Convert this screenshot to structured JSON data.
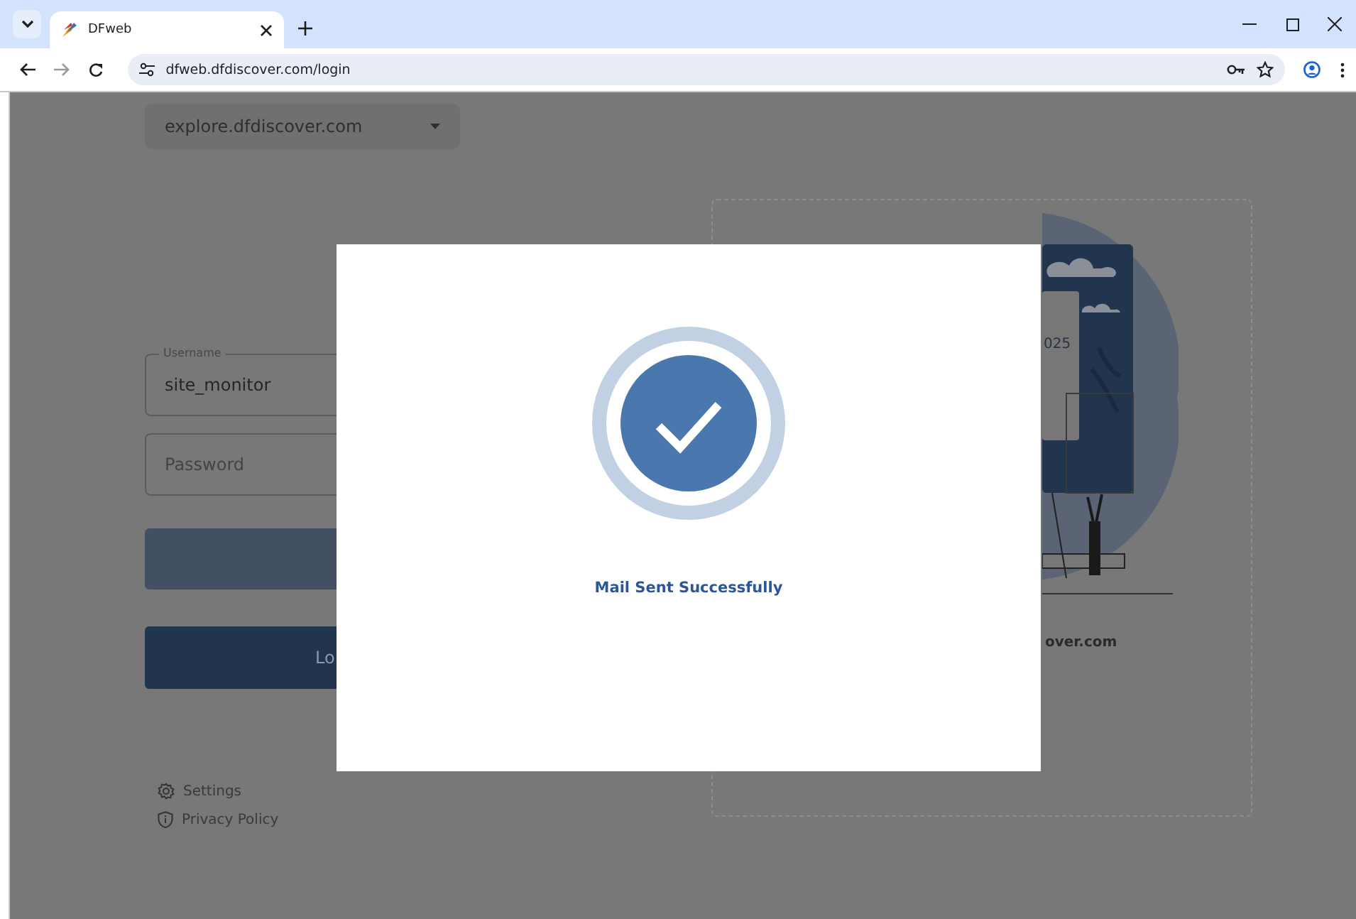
{
  "browser": {
    "tab": {
      "title": "DFweb",
      "selected": true
    },
    "url": "dfweb.dfdiscover.com/login"
  },
  "login": {
    "server_select": {
      "value": "explore.dfdiscover.com"
    },
    "username": {
      "label": "Username",
      "value": "site_monitor"
    },
    "password": {
      "placeholder": "Password"
    },
    "login_button": {
      "label": "Lo"
    },
    "links": [
      {
        "kind": "settings",
        "label": "Settings"
      },
      {
        "kind": "privacy",
        "label": "Privacy Policy"
      }
    ]
  },
  "illustration": {
    "screen_text": "025",
    "caption": "over.com"
  },
  "dialog": {
    "message": "Mail Sent Successfully"
  }
}
